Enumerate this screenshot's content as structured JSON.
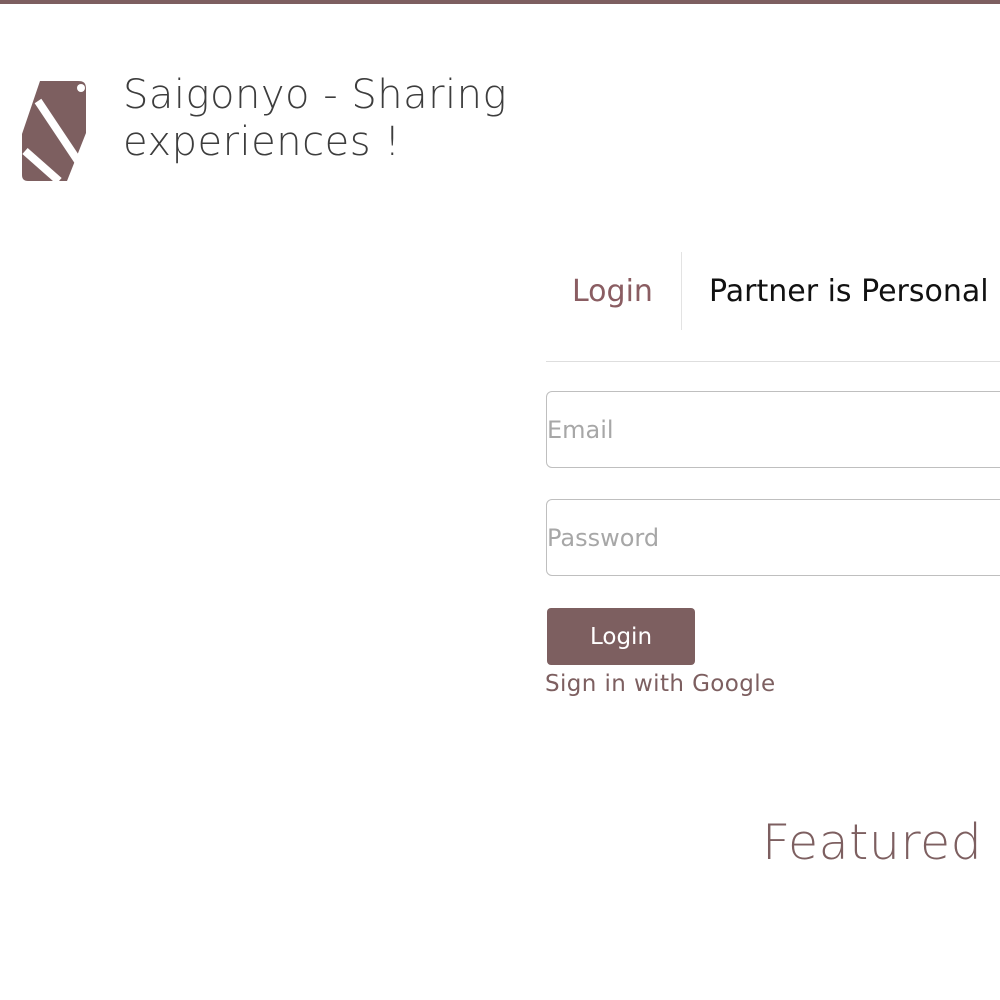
{
  "header": {
    "site_title": "Saigonyo - Sharing experiences !",
    "logo_letter": "S"
  },
  "tabs": [
    {
      "label": "Login",
      "active": true
    },
    {
      "label": "Partner is Personal",
      "active": false
    }
  ],
  "form": {
    "email": {
      "value": "",
      "placeholder": "Email"
    },
    "password": {
      "value": "",
      "placeholder": "Password"
    },
    "login_button": "Login",
    "google_link": "Sign in with Google"
  },
  "featured": {
    "heading": "Featured"
  },
  "colors": {
    "accent": "#7d5f60",
    "text": "#3d3d3d",
    "border": "#bfbfbf"
  }
}
